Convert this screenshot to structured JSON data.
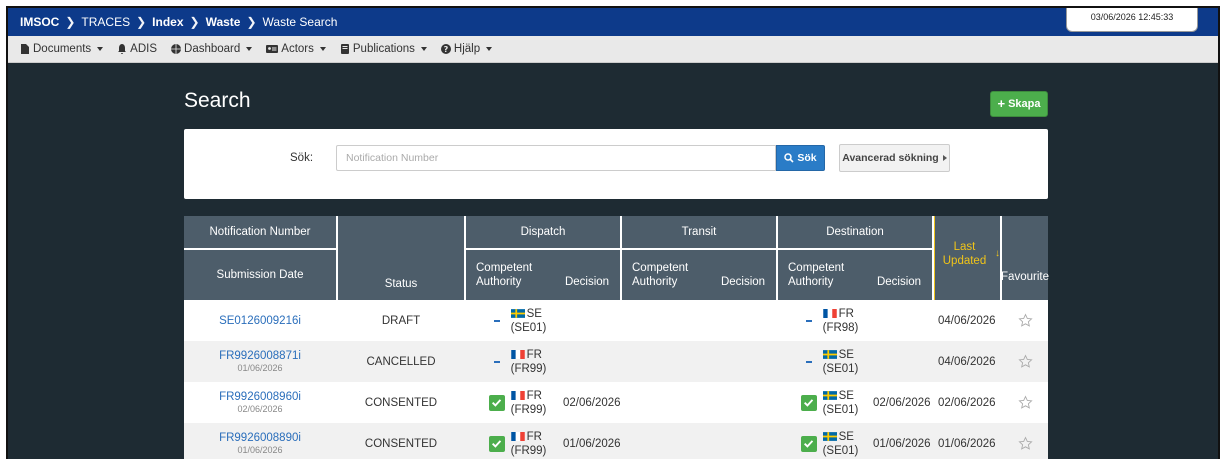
{
  "topbar": {
    "crumbs": [
      {
        "label": "IMSOC",
        "bold": true
      },
      {
        "label": "TRACES",
        "bold": false
      },
      {
        "label": "Index",
        "bold": true
      },
      {
        "label": "Waste",
        "bold": true
      },
      {
        "label": "Waste Search",
        "bold": false
      }
    ],
    "clock": "03/06/2026 12:45:33"
  },
  "menu": [
    {
      "label": "Documents",
      "icon": "document-icon",
      "caret": true
    },
    {
      "label": "ADIS",
      "icon": "bell-icon",
      "caret": false
    },
    {
      "label": "Dashboard",
      "icon": "globe-icon",
      "caret": true
    },
    {
      "label": "Actors",
      "icon": "id-card-icon",
      "caret": true
    },
    {
      "label": "Publications",
      "icon": "book-icon",
      "caret": true
    },
    {
      "label": "Hjälp",
      "icon": "question-icon",
      "caret": true
    }
  ],
  "page": {
    "title": "Search",
    "create_label": "Skapa"
  },
  "search": {
    "label": "Sök:",
    "placeholder": "Notification Number",
    "value": "",
    "button_label": "Sök",
    "advanced_label": "Avancerad sökning"
  },
  "table": {
    "headers": {
      "notification_number": "Notification Number",
      "submission_date": "Submission Date",
      "status": "Status",
      "dispatch": "Dispatch",
      "transit": "Transit",
      "destination": "Destination",
      "competent_authority": "Competent Authority",
      "decision": "Decision",
      "last_updated": "Last Updated",
      "favourite": "Favourite"
    },
    "rows": [
      {
        "number": "SE0126009216i",
        "submitted": "",
        "status": "DRAFT",
        "dispatch": {
          "mark": "minus",
          "country": "SE",
          "code": "(SE01)",
          "decision": ""
        },
        "destination": {
          "mark": "minus",
          "country": "FR",
          "code": "(FR98)",
          "decision": ""
        },
        "last_updated": "04/06/2026"
      },
      {
        "number": "FR9926008871i",
        "submitted": "01/06/2026",
        "status": "CANCELLED",
        "dispatch": {
          "mark": "minus",
          "country": "FR",
          "code": "(FR99)",
          "decision": ""
        },
        "destination": {
          "mark": "minus",
          "country": "SE",
          "code": "(SE01)",
          "decision": ""
        },
        "last_updated": "04/06/2026"
      },
      {
        "number": "FR9926008960i",
        "submitted": "02/06/2026",
        "status": "CONSENTED",
        "dispatch": {
          "mark": "check",
          "country": "FR",
          "code": "(FR99)",
          "decision": "02/06/2026"
        },
        "destination": {
          "mark": "check",
          "country": "SE",
          "code": "(SE01)",
          "decision": "02/06/2026"
        },
        "last_updated": "02/06/2026"
      },
      {
        "number": "FR9926008890i",
        "submitted": "01/06/2026",
        "status": "CONSENTED",
        "dispatch": {
          "mark": "check",
          "country": "FR",
          "code": "(FR99)",
          "decision": "01/06/2026"
        },
        "destination": {
          "mark": "check",
          "country": "SE",
          "code": "(SE01)",
          "decision": "01/06/2026"
        },
        "last_updated": "01/06/2026"
      }
    ]
  },
  "colors": {
    "topbar": "#0d3a8a",
    "background": "#1e2b33",
    "header": "#4d5d6a",
    "link": "#2a6ebb",
    "success": "#4cae4c",
    "sort_accent": "#f0c419"
  }
}
